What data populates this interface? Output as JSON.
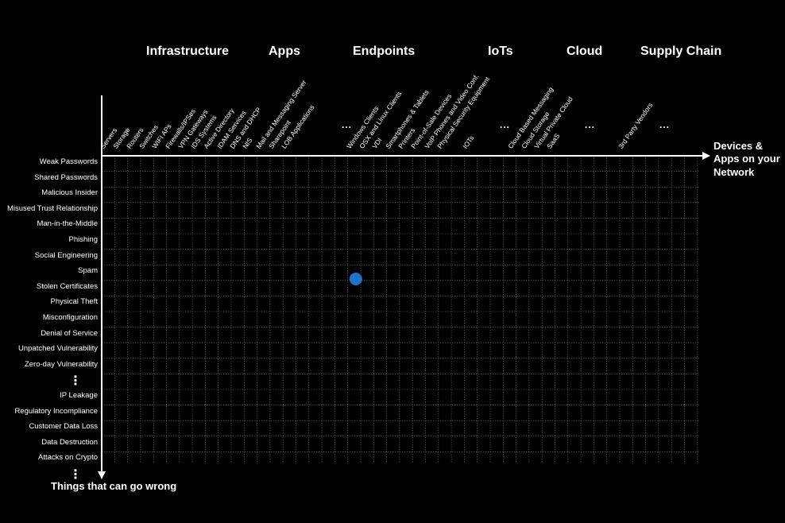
{
  "categories": [
    "Infrastructure",
    "Apps",
    "Endpoints",
    "IoTs",
    "Cloud",
    "Supply Chain"
  ],
  "columns": {
    "infrastructure": [
      "Servers",
      "Storage",
      "Routers",
      "Switches",
      "WIFI APs",
      "Firewalls/IPSes",
      "VPN Gateways",
      "IDS Systems",
      "Active Directory",
      "IDAM Services",
      "DNS and DHCP",
      "NIS"
    ],
    "apps": [
      "Mail and Messaging Server",
      "Sharepoint",
      "LOB Applications"
    ],
    "apps_more": "...",
    "endpoints": [
      "Windows Clients",
      "OSX and Linux Clients",
      "VDI",
      "Smartphones & Tablets",
      "Printers",
      "Point-of-Sale Devices",
      "VoIP Phones and Video Conf.",
      "Physical Security Equipment"
    ],
    "iots": [
      "IOTs"
    ],
    "iots_more": "...",
    "cloud": [
      "Cloud Based Messaging",
      "Cloud Storage",
      "Virtual Private Cloud",
      "SaaS"
    ],
    "cloud_more": "...",
    "supply_chain": [
      "3rd Party Vendors"
    ],
    "supply_chain_more": "..."
  },
  "rows": [
    "Weak Passwords",
    "Shared Passwords",
    "Malicious Insider",
    "Misused Trust Relationship",
    "Man-in-the-Middle",
    "Phishing",
    "Social Engineering",
    "Spam",
    "Stolen Certificates",
    "Physical Theft",
    "Misconfiguration",
    "Denial of Service",
    "Unpatched Vulnerability",
    "Zero-day Vulnerability",
    "IP Leakage",
    "Regulatory Incompliance",
    "Customer Data Loss",
    "Data Destruction",
    "Attacks on Crypto"
  ],
  "row_ellipsis": "⋮",
  "x_axis_title": "Devices & Apps on your Network",
  "y_axis_title": "Things that can go wrong",
  "marker": {
    "row": "Spam",
    "column": "Windows Clients",
    "color": "#1f73c8"
  },
  "colors": {
    "background": "#000000",
    "grid": "#6b6b6b",
    "axis": "#ffffff",
    "text": "#ffffff"
  }
}
